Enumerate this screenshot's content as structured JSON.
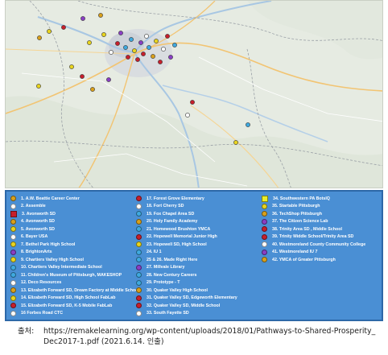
{
  "map": {
    "markers": [
      {
        "color": "#d9a01c"
      },
      {
        "color": "#e8d41e"
      },
      {
        "color": "#c61f2c"
      },
      {
        "color": "#8a3fc4"
      },
      {
        "color": "#e8d41e"
      },
      {
        "color": "#d9a01c"
      },
      {
        "color": "#e8d41e"
      },
      {
        "color": "#ffffff"
      },
      {
        "color": "#c61f2c"
      },
      {
        "color": "#8a3fc4"
      },
      {
        "color": "#3fa9df"
      },
      {
        "color": "#c61f2c"
      },
      {
        "color": "#3fa9df"
      },
      {
        "color": "#e8d41e"
      },
      {
        "color": "#c61f2c"
      },
      {
        "color": "#8a3fc4"
      },
      {
        "color": "#c61f2c"
      },
      {
        "color": "#ffffff"
      },
      {
        "color": "#3fa9df"
      },
      {
        "color": "#d9a01c"
      },
      {
        "color": "#e8d41e"
      },
      {
        "color": "#c61f2c"
      },
      {
        "color": "#ffffff"
      },
      {
        "color": "#c61f2c"
      },
      {
        "color": "#8a3fc4"
      },
      {
        "color": "#3fa9df"
      },
      {
        "color": "#e8d41e"
      },
      {
        "color": "#c61f2c"
      },
      {
        "color": "#d9a01c"
      },
      {
        "color": "#8a3fc4"
      },
      {
        "color": "#e8d41e"
      },
      {
        "color": "#c61f2c"
      },
      {
        "color": "#ffffff"
      },
      {
        "color": "#e8d41e"
      },
      {
        "color": "#3fa9df"
      }
    ]
  },
  "legend": {
    "items": [
      {
        "label": "1. A.W. Beattie Career Center",
        "color": "#d9a01c",
        "shape": "circle"
      },
      {
        "label": "2. Assemble",
        "color": "#ffffff",
        "shape": "circle"
      },
      {
        "label": "3. Avonworth SD",
        "color": "#c61f2c",
        "shape": "square"
      },
      {
        "label": "4. Avonworth SD",
        "color": "#d9a01c",
        "shape": "circle"
      },
      {
        "label": "5. Avonworth SD",
        "color": "#e8d41e",
        "shape": "circle"
      },
      {
        "label": "6. Bayer USA",
        "color": "#ffffff",
        "shape": "circle"
      },
      {
        "label": "7. Bethel Park High School",
        "color": "#e8d41e",
        "shape": "circle"
      },
      {
        "label": "8. BrightonArts",
        "color": "#8a3fc4",
        "shape": "circle"
      },
      {
        "label": "9. Chartiers Valley High School",
        "color": "#e8d41e",
        "shape": "circle"
      },
      {
        "label": "10. Chartiers Valley Intermediate School",
        "color": "#3fa9df",
        "shape": "circle"
      },
      {
        "label": "11. Children's Museum of Pittsburgh, MAKESHOP",
        "color": "#3fa9df",
        "shape": "circle"
      },
      {
        "label": "12. Deco Resources",
        "color": "#ffffff",
        "shape": "circle"
      },
      {
        "label": "13. Elizabeth Forward SD, Dream Factory at Middle School",
        "color": "#d9a01c",
        "shape": "circle"
      },
      {
        "label": "14. Elizabeth Forward SD, High School FabLab",
        "color": "#e8d41e",
        "shape": "circle"
      },
      {
        "label": "15. Elizabeth Forward SD, K-5 Mobile FabLab",
        "color": "#c61f2c",
        "shape": "circle"
      },
      {
        "label": "16 Forbes Road CTC",
        "color": "#ffffff",
        "shape": "circle"
      },
      {
        "label": "17. Forest Grove Elementary",
        "color": "#c61f2c",
        "shape": "circle"
      },
      {
        "label": "18. Fort Cherry SD",
        "color": "#ffffff",
        "shape": "circle"
      },
      {
        "label": "19. Fox Chapel Area SD",
        "color": "#3fa9df",
        "shape": "circle"
      },
      {
        "label": "20. Holy Family Academy",
        "color": "#d9a01c",
        "shape": "circle"
      },
      {
        "label": "21. Homewood Brushton YMCA",
        "color": "#3fa9df",
        "shape": "circle"
      },
      {
        "label": "22. Hopewell Memorial Junior High",
        "color": "#c61f2c",
        "shape": "circle"
      },
      {
        "label": "23. Hopewell SD, High School",
        "color": "#e8d41e",
        "shape": "circle"
      },
      {
        "label": "24. IU 1",
        "color": "#3fa9df",
        "shape": "circle"
      },
      {
        "label": "25 & 26. Made Right Here",
        "color": "#3fa9df",
        "shape": "circle"
      },
      {
        "label": "27. Millvale Library",
        "color": "#8a3fc4",
        "shape": "circle"
      },
      {
        "label": "28. New Century Careers",
        "color": "#3fa9df",
        "shape": "circle"
      },
      {
        "label": "29. Prototype - T",
        "color": "#3fa9df",
        "shape": "circle"
      },
      {
        "label": "30. Quaker Valley High School",
        "color": "#d9a01c",
        "shape": "circle"
      },
      {
        "label": "31. Quaker Valley SD, Edgeworth Elementary",
        "color": "#c61f2c",
        "shape": "circle"
      },
      {
        "label": "32. Quaker Valley SD, Middle School",
        "color": "#c61f2c",
        "shape": "circle"
      },
      {
        "label": "33. South Fayette SD",
        "color": "#ffffff",
        "shape": "circle"
      },
      {
        "label": "34. Southwestern PA BotsIQ",
        "color": "#e8ec2a",
        "shape": "square"
      },
      {
        "label": "35. Startable Pittsburgh",
        "color": "#e8d41e",
        "shape": "circle"
      },
      {
        "label": "36. TechShop Pittsburgh",
        "color": "#d9a01c",
        "shape": "circle"
      },
      {
        "label": "37. The Citizen Science Lab",
        "color": "#8a3fc4",
        "shape": "circle"
      },
      {
        "label": "38. Trinity Area SD , Middle School",
        "color": "#c61f2c",
        "shape": "circle"
      },
      {
        "label": "39. Trinity Middle School/Trinity Area SD",
        "color": "#c61f2c",
        "shape": "circle"
      },
      {
        "label": "40. Westmoreland County Community College",
        "color": "#ffffff",
        "shape": "circle"
      },
      {
        "label": "41. Westmoreland IU 7",
        "color": "#8a3fc4",
        "shape": "circle"
      },
      {
        "label": "42. YMCA of Greater Pittsburgh",
        "color": "#d9a01c",
        "shape": "circle"
      }
    ]
  },
  "source": {
    "prefix": "출처:",
    "line1": "https://remakelearning.org/wp-content/uploads/2018/01/Pathways-to-Shared-Prosperity_",
    "line2": "Dec2017-1.pdf (2021.6.14. 인출)"
  }
}
